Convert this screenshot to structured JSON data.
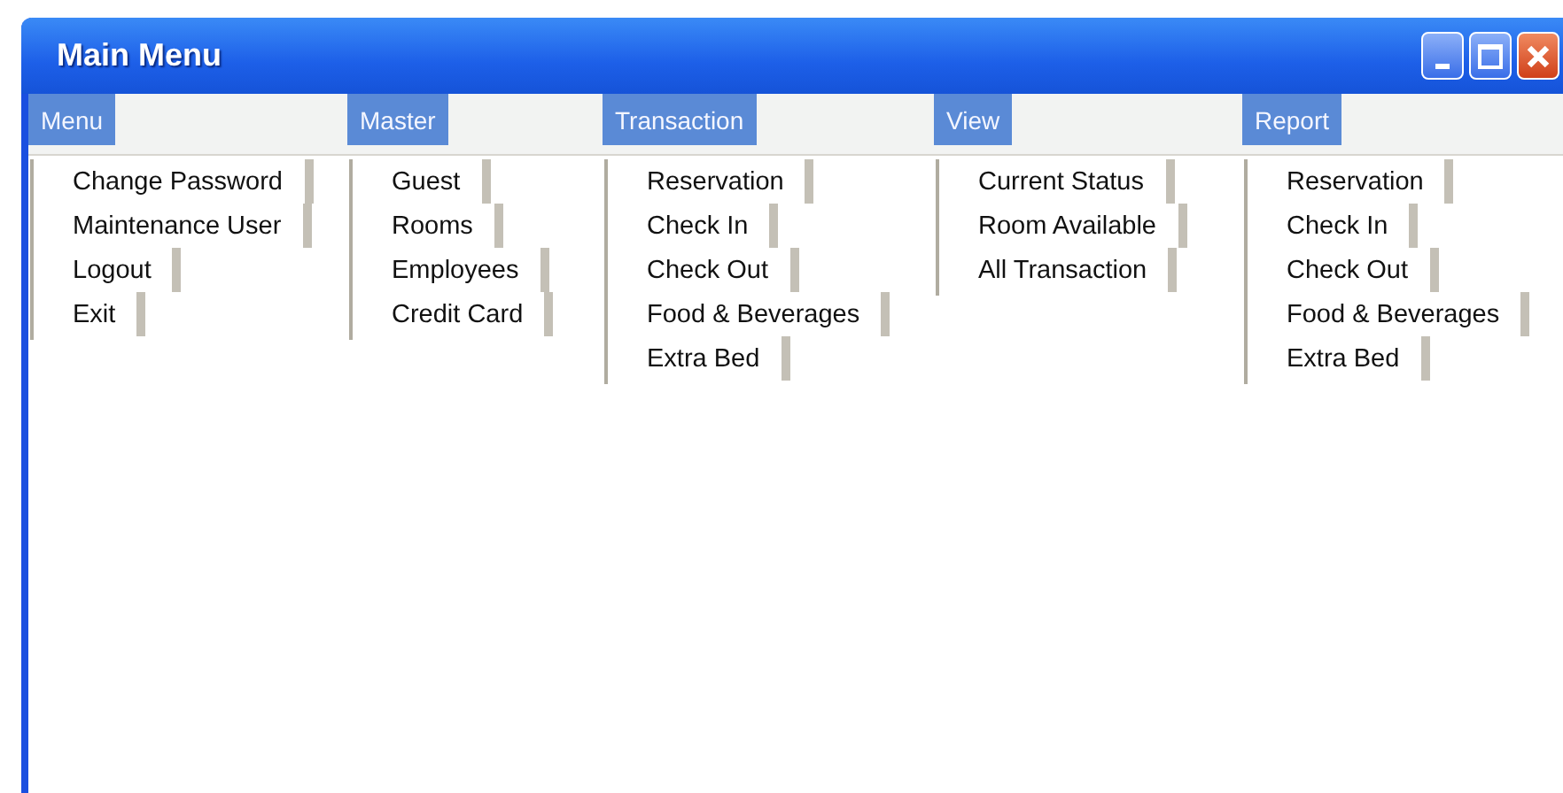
{
  "window": {
    "title": "Main Menu"
  },
  "menus": [
    {
      "label": "Menu",
      "items": [
        "Change Password",
        "Maintenance User",
        "Logout",
        "Exit"
      ]
    },
    {
      "label": "Master",
      "items": [
        "Guest",
        "Rooms",
        "Employees",
        "Credit Card"
      ]
    },
    {
      "label": "Transaction",
      "items": [
        "Reservation",
        "Check In",
        "Check Out",
        "Food & Beverages",
        "Extra Bed"
      ]
    },
    {
      "label": "View",
      "items": [
        "Current Status",
        "Room Available",
        "All Transaction"
      ]
    },
    {
      "label": "Report",
      "items": [
        "Reservation",
        "Check In",
        "Check Out",
        "Food & Beverages",
        "Extra Bed"
      ]
    }
  ]
}
